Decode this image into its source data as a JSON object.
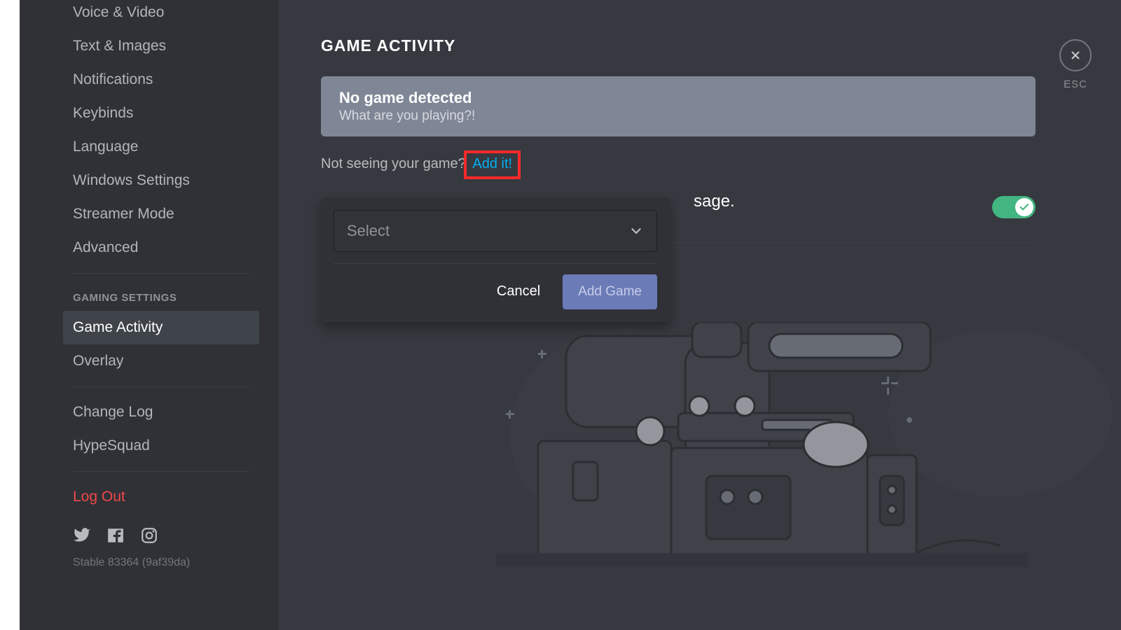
{
  "sidebar": {
    "items": [
      {
        "label": "Voice & Video"
      },
      {
        "label": "Text & Images"
      },
      {
        "label": "Notifications"
      },
      {
        "label": "Keybinds"
      },
      {
        "label": "Language"
      },
      {
        "label": "Windows Settings"
      },
      {
        "label": "Streamer Mode"
      },
      {
        "label": "Advanced"
      }
    ],
    "gaming_header": "GAMING SETTINGS",
    "gaming_items": [
      {
        "label": "Game Activity"
      },
      {
        "label": "Overlay"
      }
    ],
    "misc_items": [
      {
        "label": "Change Log"
      },
      {
        "label": "HypeSquad"
      }
    ],
    "logout_label": "Log Out",
    "version": "Stable 83364 (9af39da)"
  },
  "main": {
    "title": "GAME ACTIVITY",
    "banner_title": "No game detected",
    "banner_sub": "What are you playing?!",
    "prompt_text": "Not seeing your game?",
    "prompt_link": "Add it!",
    "status_peek": "sage.",
    "toggle_on": true
  },
  "popover": {
    "select_placeholder": "Select",
    "cancel_label": "Cancel",
    "add_label": "Add Game"
  },
  "close": {
    "esc_label": "ESC"
  }
}
